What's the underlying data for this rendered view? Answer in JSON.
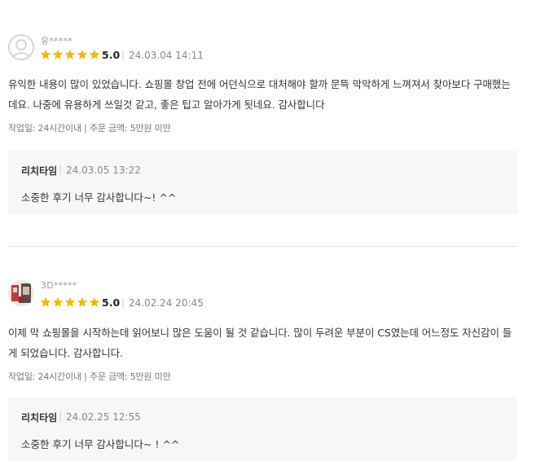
{
  "colors": {
    "star": "#f5b800",
    "reply_bg": "#f7f7f7",
    "divider": "#e5e5e5"
  },
  "reviews": [
    {
      "user": "유*****",
      "avatar_icon": "default-user-icon",
      "rating": 5,
      "score": "5.0",
      "date": "24.03.04 14:11",
      "text": "유익한 내용이 많이 있었습니다. 쇼핑몰 창업 전에 어던식으로 대처해야 할까 문뜩 막막하게 느껴져서 찾아보다 구매했는데요. 나중에 유용하게 쓰일것 같고, 좋은 팁고 알아가게 됫네요. 감사합니다",
      "meta": "작업일: 24시간이내 | 주문 금액: 5만원 미만",
      "reply": {
        "author": "리치타임",
        "date": "24.03.05 13:22",
        "text": "소중한 후기 너무 감사합니다~! ^^"
      }
    },
    {
      "user": "3D*****",
      "avatar_icon": "user-photo-icon",
      "rating": 5,
      "score": "5.0",
      "date": "24.02.24 20:45",
      "text": "이제 막 쇼핑몰을 시작하는데 읽어보니 많은 도움이 될 것 같습니다. 많이 두려운 부분이 CS였는데 어느정도 자신감이 들게 되었습니다. 감사합니다.",
      "meta": "작업일: 24시간이내 | 주문 금액: 5만원 미만",
      "reply": {
        "author": "리치타임",
        "date": "24.02.25 12:55",
        "text": "소중한 후기 너무 감사합니다~ ! ^^"
      }
    }
  ]
}
